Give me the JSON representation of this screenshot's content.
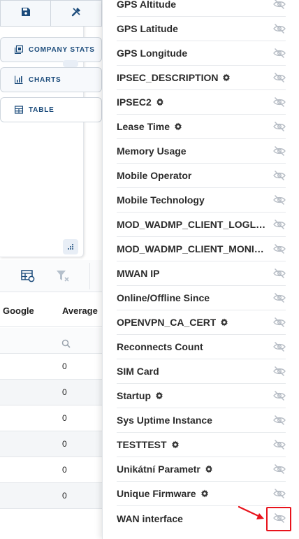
{
  "left_panel": {
    "toolbar": {
      "save_icon": "save-icon",
      "edit_icon": "wrench-icon"
    },
    "nav": [
      {
        "label": "COMPANY STATS",
        "icon": "stats-icon"
      },
      {
        "label": "CHARTS",
        "icon": "chart-icon"
      },
      {
        "label": "TABLE",
        "icon": "table-icon"
      }
    ],
    "grid": {
      "columns": [
        "Google",
        "Average"
      ],
      "rows": [
        "0",
        "0",
        "0",
        "0",
        "0",
        "0"
      ]
    }
  },
  "column_chooser": {
    "items": [
      {
        "label": "GPS Altitude",
        "settings": false
      },
      {
        "label": "GPS Latitude",
        "settings": false
      },
      {
        "label": "GPS Longitude",
        "settings": false
      },
      {
        "label": "IPSEC_DESCRIPTION",
        "settings": true
      },
      {
        "label": "IPSEC2",
        "settings": true
      },
      {
        "label": "Lease Time",
        "settings": true
      },
      {
        "label": "Memory Usage",
        "settings": false
      },
      {
        "label": "Mobile Operator",
        "settings": false
      },
      {
        "label": "Mobile Technology",
        "settings": false
      },
      {
        "label": "MOD_WADMP_CLIENT_LOGLEVE...",
        "settings": false
      },
      {
        "label": "MOD_WADMP_CLIENT_MONITO...",
        "settings": false
      },
      {
        "label": "MWAN IP",
        "settings": false
      },
      {
        "label": "Online/Offline Since",
        "settings": false
      },
      {
        "label": "OPENVPN_CA_CERT",
        "settings": true
      },
      {
        "label": "Reconnects Count",
        "settings": false
      },
      {
        "label": "SIM Card",
        "settings": false
      },
      {
        "label": "Startup",
        "settings": true
      },
      {
        "label": "Sys Uptime Instance",
        "settings": false
      },
      {
        "label": "TESTTEST",
        "settings": true
      },
      {
        "label": "Unikátní Parametr",
        "settings": true
      },
      {
        "label": "Unique Firmware",
        "settings": true
      },
      {
        "label": "WAN interface",
        "settings": false
      }
    ]
  },
  "colors": {
    "accent": "#1a4a7a",
    "eye_icon": "#b8bec6",
    "highlight": "#e8131c"
  }
}
